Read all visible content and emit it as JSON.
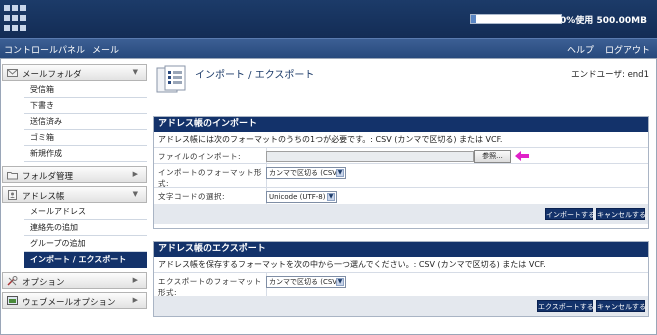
{
  "header": {
    "usage_percent": 0.05,
    "usage_text": "0%使用 500.00MB"
  },
  "nav": {
    "control_panel": "コントロールパネル",
    "mail": "メール",
    "help": "ヘルプ",
    "logout": "ログアウト"
  },
  "sidebar": {
    "mail_folder": {
      "label": "メールフォルダ",
      "items": [
        "受信箱",
        "下書き",
        "送信済み",
        "ゴミ箱",
        "新規作成"
      ]
    },
    "folder_manage": {
      "label": "フォルダ管理"
    },
    "address_book": {
      "label": "アドレス帳",
      "items": [
        "メールアドレス",
        "連絡先の追加",
        "グループの追加",
        "インポート / エクスポート"
      ]
    },
    "options": {
      "label": "オプション"
    },
    "webmail_options": {
      "label": "ウェブメールオプション"
    }
  },
  "page": {
    "title": "インポート / エクスポート",
    "end_user": "エンドユーザ: end1"
  },
  "import_panel": {
    "heading": "アドレス帳のインポート",
    "description": "アドレス帳には次のフォーマットのうちの1つが必要です。: CSV (カンマで区切る) または VCF.",
    "file_label": "ファイルのインポート:",
    "browse_label": "参照...",
    "format_label": "インポートのフォーマット形式:",
    "format_value": "カンマで区切る (CSV)",
    "charset_label": "文字コードの選択:",
    "charset_value": "Unicode (UTF-8)",
    "import_button": "インポートする",
    "cancel_button": "キャンセルする"
  },
  "export_panel": {
    "heading": "アドレス帳のエクスポート",
    "description": "アドレス帳を保存するフォーマットを次の中から一つ選んでください。: CSV (カンマで区切る) または VCF.",
    "format_label": "エクスポートのフォーマット形式:",
    "format_value": "カンマで区切る (CSV)",
    "export_button": "エクスポートする",
    "cancel_button": "キャンセルする"
  },
  "colors": {
    "header_bg": "#132c55",
    "panel_head": "#13326a",
    "highlight_arrow": "#e020c8"
  }
}
